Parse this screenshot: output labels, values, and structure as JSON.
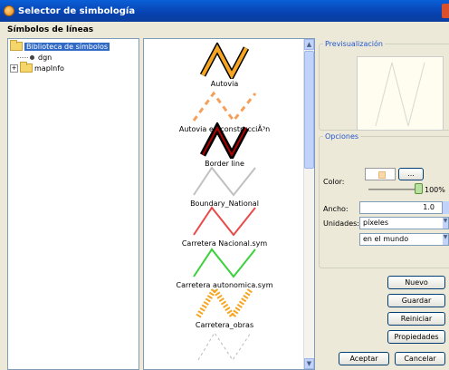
{
  "window": {
    "title": "Selector de simbología"
  },
  "header": {
    "section_title": "Símbolos de líneas"
  },
  "tree": {
    "items": [
      {
        "label": "Biblioteca de símbolos",
        "selected": true
      },
      {
        "label": "dgn"
      },
      {
        "label": "mapInfo"
      }
    ]
  },
  "symbols": [
    {
      "label": "Autovia",
      "color": "#f5a623",
      "outline": "#000000"
    },
    {
      "label": "Autovia en construcciÃ³n",
      "color": "#f5a05a",
      "dashed": true
    },
    {
      "label": "Border line",
      "color": "#b00000",
      "outline": "#000000"
    },
    {
      "label": "Boundary_National",
      "color": "#c0c0c0"
    },
    {
      "label": "Carretera Nacional.sym",
      "color": "#e94b4b"
    },
    {
      "label": "Carretera autonomica.sym",
      "color": "#3cd13c"
    },
    {
      "label": "Carretera_obras",
      "color": "#f5a623",
      "dotted": true
    },
    {
      "label": "",
      "color": "#bbbbbb",
      "dashed": true
    }
  ],
  "preview": {
    "title": "Previsualización"
  },
  "options": {
    "title": "Opciones",
    "color_label": "Color:",
    "color_button": "...",
    "opacity_value": "100%",
    "width_label": "Ancho:",
    "width_value": "1.0",
    "units_label": "Unidades:",
    "units_value": "píxeles",
    "units_ref_value": "en el mundo"
  },
  "buttons": {
    "new": "Nuevo",
    "save": "Guardar",
    "reset": "Reiniciar",
    "properties": "Propiedades",
    "accept": "Aceptar",
    "cancel": "Cancelar"
  }
}
